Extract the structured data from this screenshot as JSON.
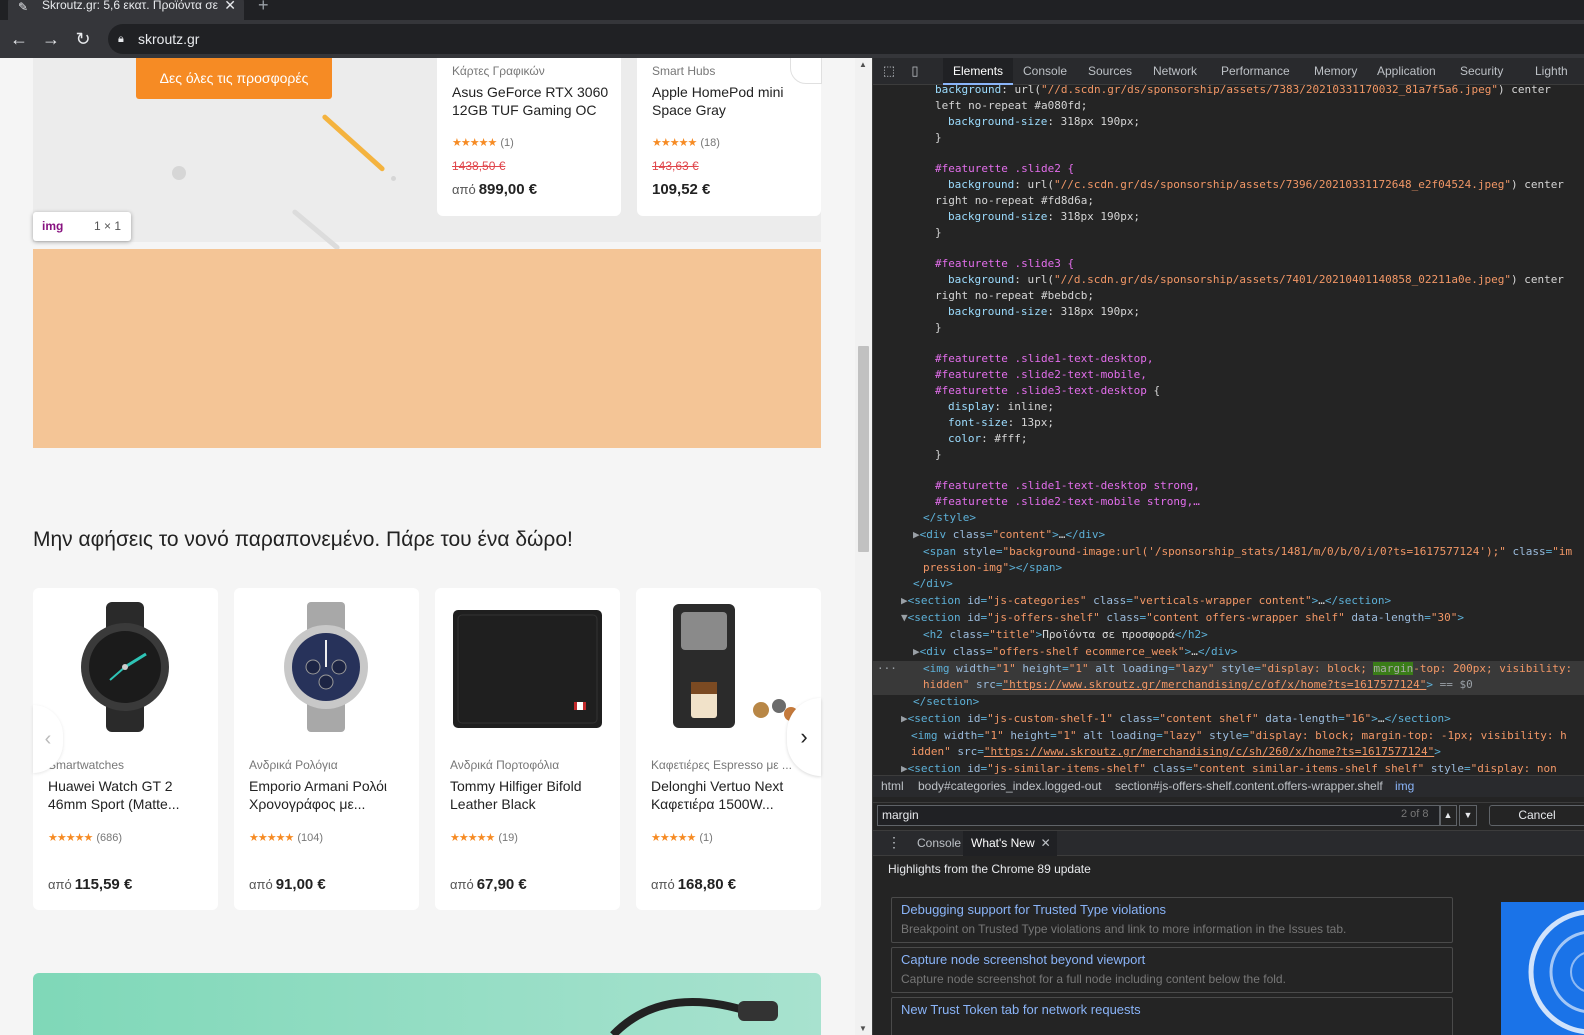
{
  "browser": {
    "tab_title": "Skroutz.gr: 5,6 εκατ. Προϊόντα σε",
    "url": "skroutz.gr"
  },
  "page": {
    "offers_button": "Δες όλες τις προσφορές",
    "top_products": [
      {
        "category": "Κάρτες Γραφικών",
        "name_line1": "Asus GeForce RTX 3060",
        "name_line2": "12GB TUF Gaming OC",
        "stars": "★★★★★",
        "reviews": "(1)",
        "old_price": "1438,50 €",
        "price_prefix": "από",
        "price": "899,00 €"
      },
      {
        "category": "Smart Hubs",
        "name_line1": "Apple HomePod mini",
        "name_line2": "Space Gray",
        "stars": "★★★★★",
        "reviews": "(18)",
        "old_price": "143,63 €",
        "price_prefix": "",
        "price": "109,52 €"
      }
    ],
    "inspect_tooltip": {
      "tag": "img",
      "dims": "1 × 1"
    },
    "shelf_title": "Μην αφήσεις το νονό παραπονεμένο. Πάρε του ένα δώρο!",
    "products": [
      {
        "category": "Smartwatches",
        "name_line1": "Huawei Watch GT 2",
        "name_line2": "46mm Sport (Matte...",
        "stars": "★★★★★",
        "reviews": "(686)",
        "price_prefix": "από",
        "price": "115,59 €"
      },
      {
        "category": "Ανδρικά Ρολόγια",
        "name_line1": "Emporio Armani Ρολόι",
        "name_line2": "Χρονογράφος με...",
        "stars": "★★★★★",
        "reviews": "(104)",
        "price_prefix": "από",
        "price": "91,00 €"
      },
      {
        "category": "Ανδρικά Πορτοφόλια",
        "name_line1": "Tommy Hilfiger Bifold",
        "name_line2": "Leather Black",
        "stars": "★★★★★",
        "reviews": "(19)",
        "price_prefix": "από",
        "price": "67,90 €"
      },
      {
        "category": "Καφετιέρες Espresso με ...",
        "name_line1": "Delonghi Vertuo Next",
        "name_line2": "Καφετιέρα 1500W...",
        "stars": "★★★★★",
        "reviews": "(1)",
        "price_prefix": "από",
        "price": "168,80 €"
      }
    ]
  },
  "devtools": {
    "tabs": [
      "Elements",
      "Console",
      "Sources",
      "Network",
      "Performance",
      "Memory",
      "Application",
      "Security",
      "Lighth"
    ],
    "active_tab": "Elements",
    "breadcrumbs": [
      "html",
      "body#categories_index.logged-out",
      "section#js-offers-shelf.content.offers-wrapper.shelf",
      "img"
    ],
    "search": {
      "value": "margin",
      "count": "2 of 8",
      "cancel": "Cancel"
    },
    "drawer_tabs": [
      "Console",
      "What's New"
    ],
    "drawer_title": "Highlights from the Chrome 89 update",
    "whats_new": [
      {
        "title": "Debugging support for Trusted Type violations",
        "desc": "Breakpoint on Trusted Type violations and link to more information in the Issues tab."
      },
      {
        "title": "Capture node screenshot beyond viewport",
        "desc": "Capture node screenshot for a full node including content below the fold."
      },
      {
        "title": "New Trust Token tab for network requests",
        "desc": ""
      }
    ]
  }
}
